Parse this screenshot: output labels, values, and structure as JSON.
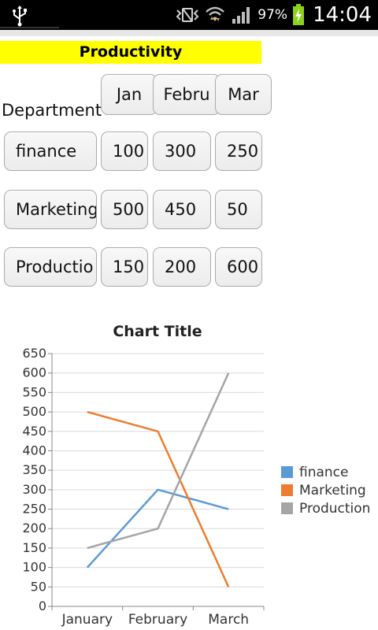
{
  "status_bar": {
    "battery": "97%",
    "time": "14:04"
  },
  "table": {
    "title": "Productivity",
    "dept_header": "Department",
    "month_headers": [
      "Jan",
      "Febru",
      "Mar"
    ],
    "rows": [
      {
        "dept": "finance",
        "values": [
          "100",
          "300",
          "250"
        ]
      },
      {
        "dept": "Marketing",
        "values": [
          "500",
          "450",
          "50"
        ]
      },
      {
        "dept": "Productio",
        "values": [
          "150",
          "200",
          "600"
        ]
      }
    ]
  },
  "chart_data": {
    "type": "line",
    "title": "Chart Title",
    "categories": [
      "January",
      "February",
      "March"
    ],
    "series": [
      {
        "name": "finance",
        "values": [
          100,
          300,
          250
        ],
        "color": "#5b9bd5"
      },
      {
        "name": "Marketing",
        "values": [
          500,
          450,
          50
        ],
        "color": "#ed7d31"
      },
      {
        "name": "Production",
        "values": [
          150,
          200,
          600
        ],
        "color": "#a5a5a5"
      }
    ],
    "ylim": [
      0,
      650
    ],
    "yticks": [
      "0",
      "50",
      "100",
      "150",
      "200",
      "250",
      "300",
      "350",
      "400",
      "450",
      "500",
      "550",
      "600",
      "650"
    ],
    "grid": true,
    "legend_position": "right"
  }
}
